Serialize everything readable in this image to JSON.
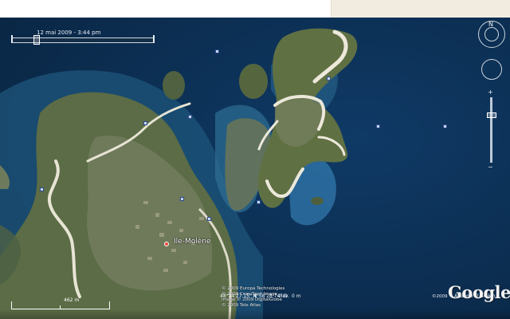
{
  "timeslider": {
    "date_label": "12 mai 2009 - 3:44 pm"
  },
  "navigation": {
    "look_icon": "look-ring-icon",
    "move_icon": "move-ring-icon",
    "zoom_in_icon": "plus-icon",
    "zoom_out_icon": "minus-icon"
  },
  "place": {
    "name": "Ile-Molène"
  },
  "scale": {
    "label": "462 m"
  },
  "credits": {
    "line1": "© 2009 Europa Technologies",
    "line2": "© 2009 Cnes/Spot Image",
    "line3": "Image © 2009 DigitalGlobe",
    "line4": "© 2009 Tele Atlas",
    "year": "©2009"
  },
  "logo": {
    "text": "Google"
  },
  "status": {
    "lat": "48°24'27.15\" N",
    "lon": "4°58'28.74\" O",
    "elev_label": "élév.",
    "elev_value": "0 m",
    "alt_label": "Altitude",
    "alt_value": "2.84 km"
  },
  "colors": {
    "ocean": "#0c2f52",
    "land": "#5e7048",
    "sand": "#e9e6d8",
    "shallow": "#3a7fb3"
  }
}
